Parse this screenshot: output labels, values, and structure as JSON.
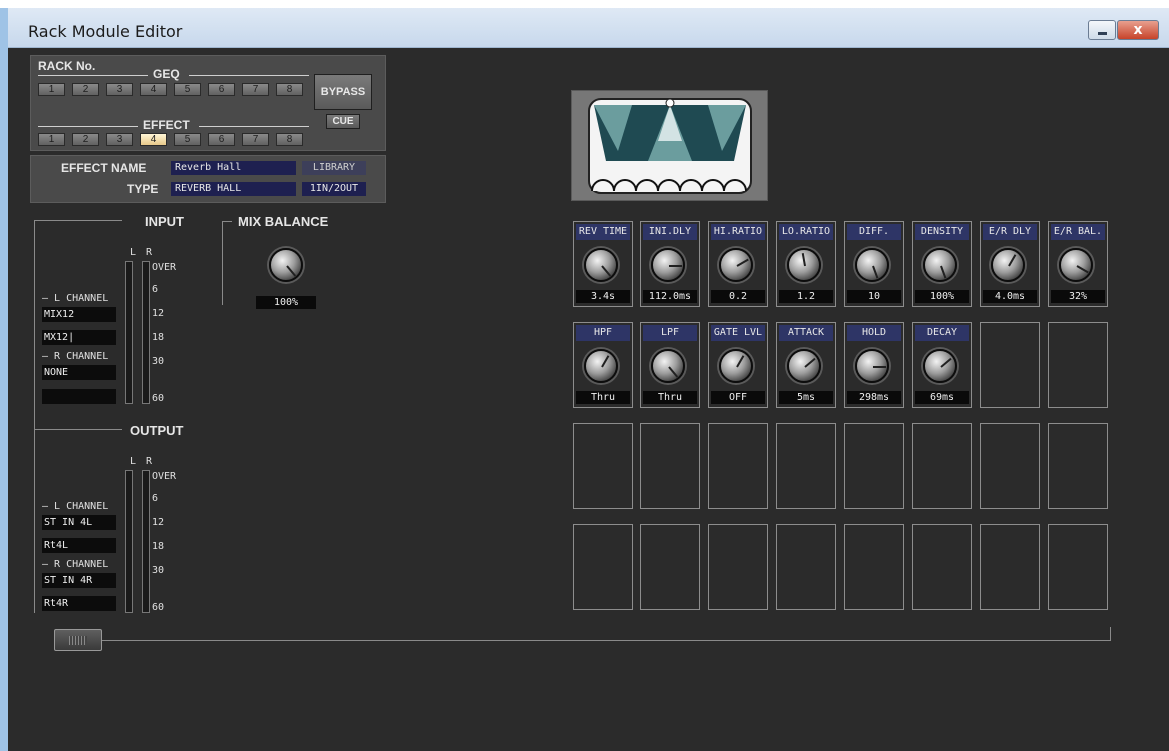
{
  "window": {
    "title": "Rack Module Editor",
    "close_glyph": "x"
  },
  "rack": {
    "label": "RACK No.",
    "geq_label": "GEQ",
    "geq_buttons": [
      "1",
      "2",
      "3",
      "4",
      "5",
      "6",
      "7",
      "8"
    ],
    "effect_label": "EFFECT",
    "effect_buttons": [
      "1",
      "2",
      "3",
      "4",
      "5",
      "6",
      "7",
      "8"
    ],
    "effect_selected": "4",
    "bypass_label": "BYPASS",
    "cue_label": "CUE"
  },
  "effect": {
    "name_label": "EFFECT NAME",
    "name_value": "Reverb Hall",
    "library_label": "LIBRARY",
    "type_label": "TYPE",
    "type_value": "REVERB HALL",
    "io_value": "1IN/2OUT"
  },
  "input": {
    "title": "INPUT",
    "l": "L",
    "r": "R",
    "l_channel_label": "L CHANNEL",
    "l_channel_value1": "MIX12",
    "l_channel_value2": "MX12|",
    "r_channel_label": "R CHANNEL",
    "r_channel_value1": "NONE",
    "r_channel_value2": ""
  },
  "mix_balance": {
    "title": "MIX BALANCE",
    "value": "100%"
  },
  "output": {
    "title": "OUTPUT",
    "l": "L",
    "r": "R",
    "l_channel_label": "L CHANNEL",
    "l_channel_value1": "ST IN 4L",
    "l_channel_value2": "Rt4L",
    "r_channel_label": "R CHANNEL",
    "r_channel_value1": "ST IN 4R",
    "r_channel_value2": "Rt4R"
  },
  "meter_scale": [
    "OVER",
    "6",
    "12",
    "18",
    "30",
    "60"
  ],
  "params_row1": [
    {
      "name": "REV TIME",
      "value": "3.4s"
    },
    {
      "name": "INI.DLY",
      "value": "112.0ms"
    },
    {
      "name": "HI.RATIO",
      "value": "0.2"
    },
    {
      "name": "LO.RATIO",
      "value": "1.2"
    },
    {
      "name": "DIFF.",
      "value": "10"
    },
    {
      "name": "DENSITY",
      "value": "100%"
    },
    {
      "name": "E/R DLY",
      "value": "4.0ms"
    },
    {
      "name": "E/R BAL.",
      "value": "32%"
    }
  ],
  "params_row2": [
    {
      "name": "HPF",
      "value": "Thru"
    },
    {
      "name": "LPF",
      "value": "Thru"
    },
    {
      "name": "GATE LVL",
      "value": "OFF"
    },
    {
      "name": "ATTACK",
      "value": "5ms"
    },
    {
      "name": "HOLD",
      "value": "298ms"
    },
    {
      "name": "DECAY",
      "value": "69ms"
    }
  ],
  "icons": {
    "effect_thumbnail": "reverb-hall-icon",
    "knob": "knob-icon"
  }
}
